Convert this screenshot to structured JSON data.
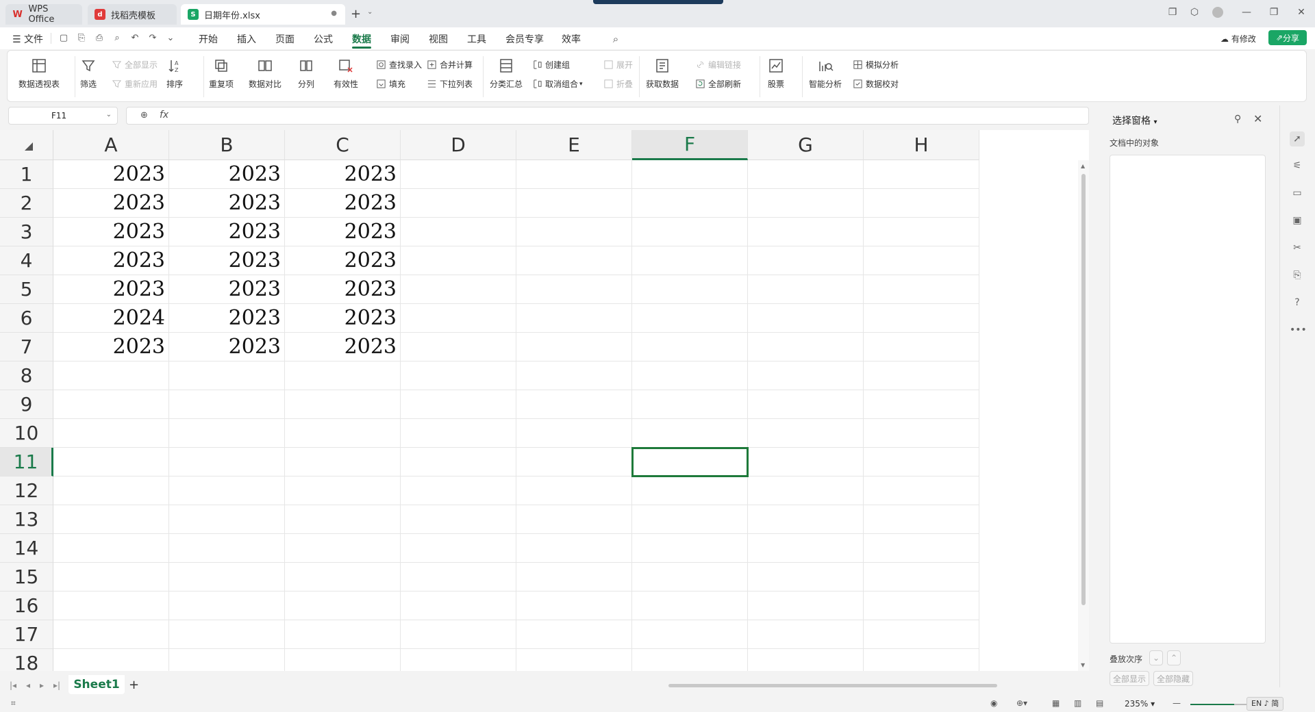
{
  "tabs": [
    {
      "label": "WPS Office",
      "icon": "wps-logo-icon"
    },
    {
      "label": "找稻壳模板",
      "icon": "docer-icon"
    },
    {
      "label": "日期年份.xlsx",
      "icon": "spreadsheet-icon"
    }
  ],
  "menu": {
    "file": "文件",
    "items": [
      "开始",
      "插入",
      "页面",
      "公式",
      "数据",
      "审阅",
      "视图",
      "工具",
      "会员专享",
      "效率"
    ],
    "active": "数据",
    "modified": "有修改",
    "share": "分享"
  },
  "ribbon": {
    "pivot": "数据透视表",
    "filter": "筛选",
    "show_all": "全部显示",
    "reapply": "重新应用",
    "sort": "排序",
    "duplicates": "重复项",
    "compare": "数据对比",
    "split": "分列",
    "validity": "有效性",
    "lookup_entry": "查找录入",
    "fill": "填充",
    "consolidate": "合并计算",
    "dropdown_list": "下拉列表",
    "subtotal": "分类汇总",
    "create_group": "创建组",
    "ungroup": "取消组合",
    "expand": "展开",
    "collapse": "折叠",
    "get_data": "获取数据",
    "edit_links": "编辑链接",
    "refresh_all": "全部刷新",
    "stocks": "股票",
    "smart_analysis": "智能分析",
    "what_if": "模拟分析",
    "data_check": "数据校对"
  },
  "formula_bar": {
    "name_box": "F11",
    "fx": "fx",
    "value": ""
  },
  "columns": [
    "A",
    "B",
    "C",
    "D",
    "E",
    "F",
    "G",
    "H"
  ],
  "rows": [
    "1",
    "2",
    "3",
    "4",
    "5",
    "6",
    "7",
    "8",
    "9",
    "10",
    "11",
    "12",
    "13",
    "14",
    "15",
    "16",
    "17",
    "18"
  ],
  "cells": [
    [
      "2023",
      "2023",
      "2023"
    ],
    [
      "2023",
      "2023",
      "2023"
    ],
    [
      "2023",
      "2023",
      "2023"
    ],
    [
      "2023",
      "2023",
      "2023"
    ],
    [
      "2023",
      "2023",
      "2023"
    ],
    [
      "2024",
      "2023",
      "2023"
    ],
    [
      "2023",
      "2023",
      "2023"
    ]
  ],
  "selected_cell": {
    "col": "F",
    "row": "11"
  },
  "panel": {
    "title": "选择窗格",
    "subtitle": "文档中的对象",
    "stack_order": "叠放次序",
    "show_all": "全部显示",
    "hide_all": "全部隐藏"
  },
  "sheets": {
    "active": "Sheet1",
    "add": "+"
  },
  "status": {
    "zoom": "235%",
    "ime": "EN ♪ 简"
  },
  "colors": {
    "accent": "#1a7a4a",
    "share_bg": "#1aa665",
    "selection": "#1e7a3a"
  }
}
